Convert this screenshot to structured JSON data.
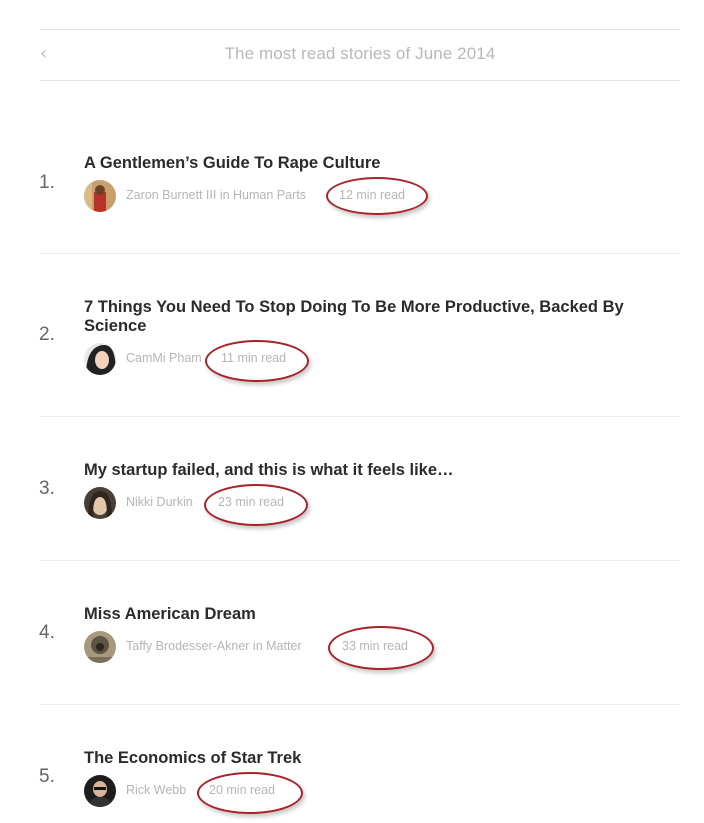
{
  "header": {
    "back_icon": "chevron-left-icon",
    "title": "The most read stories of June 2014"
  },
  "stories": [
    {
      "rank": "1.",
      "title": "A Gentlemen’s Guide To Rape Culture",
      "author": "Zaron Burnett III",
      "publication_prefix": "in",
      "publication": "Human Parts",
      "read_time": "12 min read"
    },
    {
      "rank": "2.",
      "title": "7 Things You Need To Stop Doing To Be More Productive, Backed By Science",
      "author": "CamMi Pham",
      "publication_prefix": "",
      "publication": "",
      "read_time": "11 min read"
    },
    {
      "rank": "3.",
      "title": "My startup failed, and this is what it feels like…",
      "author": "Nikki Durkin",
      "publication_prefix": "",
      "publication": "",
      "read_time": "23 min read"
    },
    {
      "rank": "4.",
      "title": "Miss American Dream",
      "author": "Taffy Brodesser-Akner",
      "publication_prefix": "in",
      "publication": "Matter",
      "read_time": "33 min read"
    },
    {
      "rank": "5.",
      "title": "The Economics of Star Trek",
      "author": "Rick Webb",
      "publication_prefix": "",
      "publication": "",
      "read_time": "20 min read"
    }
  ],
  "colors": {
    "annotation_circle": "#a8222a",
    "meta_text": "#b5b5b5",
    "title_text": "#2b2b2b"
  }
}
